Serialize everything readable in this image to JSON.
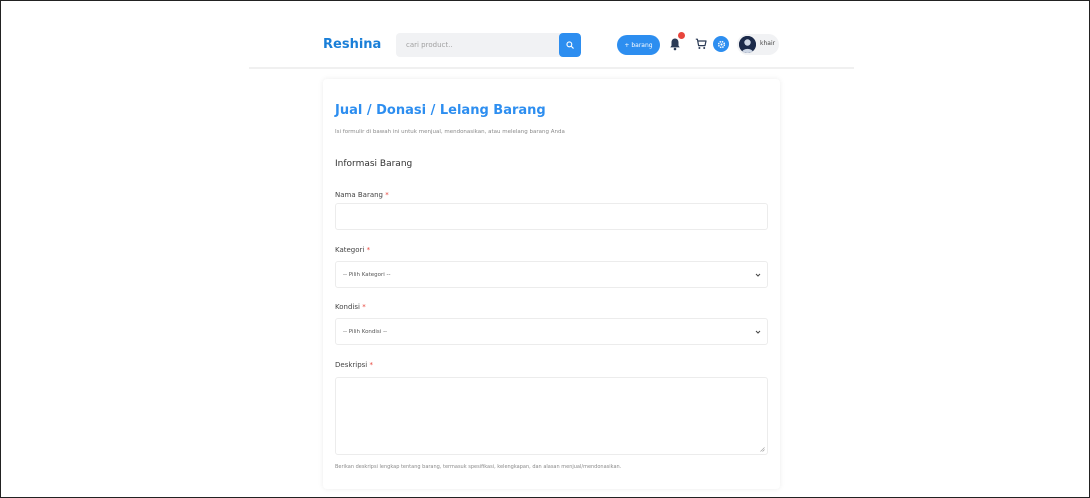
{
  "header": {
    "brand": "Reshina",
    "search_placeholder": "cari product..",
    "add_button_label": "+ barang",
    "notification_badge": "",
    "user_name": "khair"
  },
  "form": {
    "title": "Jual / Donasi / Lelang Barang",
    "subtitle": "Isi formulir di bawah ini untuk menjual, mendonasikan, atau melelang barang Anda",
    "section_title": "Informasi Barang",
    "fields": {
      "nama_label": "Nama Barang",
      "nama_value": "",
      "kategori_label": "Kategori",
      "kategori_selected": "-- Pilih Kategori --",
      "kondisi_label": "Kondisi",
      "kondisi_selected": "-- Pilih Kondisi --",
      "deskripsi_label": "Deskripsi",
      "deskripsi_value": "",
      "deskripsi_help": "Berikan deskripsi lengkap tentang barang, termasuk spesifikasi, kelengkapan, dan alasan menjual/mendonasikan."
    },
    "required_mark": "*"
  },
  "colors": {
    "accent": "#2d8ef0",
    "brand": "#1a7fd8",
    "required": "#e8453c",
    "badge": "#e8453c"
  },
  "icons": {
    "search": "search-icon",
    "bell": "bell-icon",
    "cart": "cart-icon",
    "settings": "gear-icon",
    "chevron": "chevron-down-icon"
  }
}
